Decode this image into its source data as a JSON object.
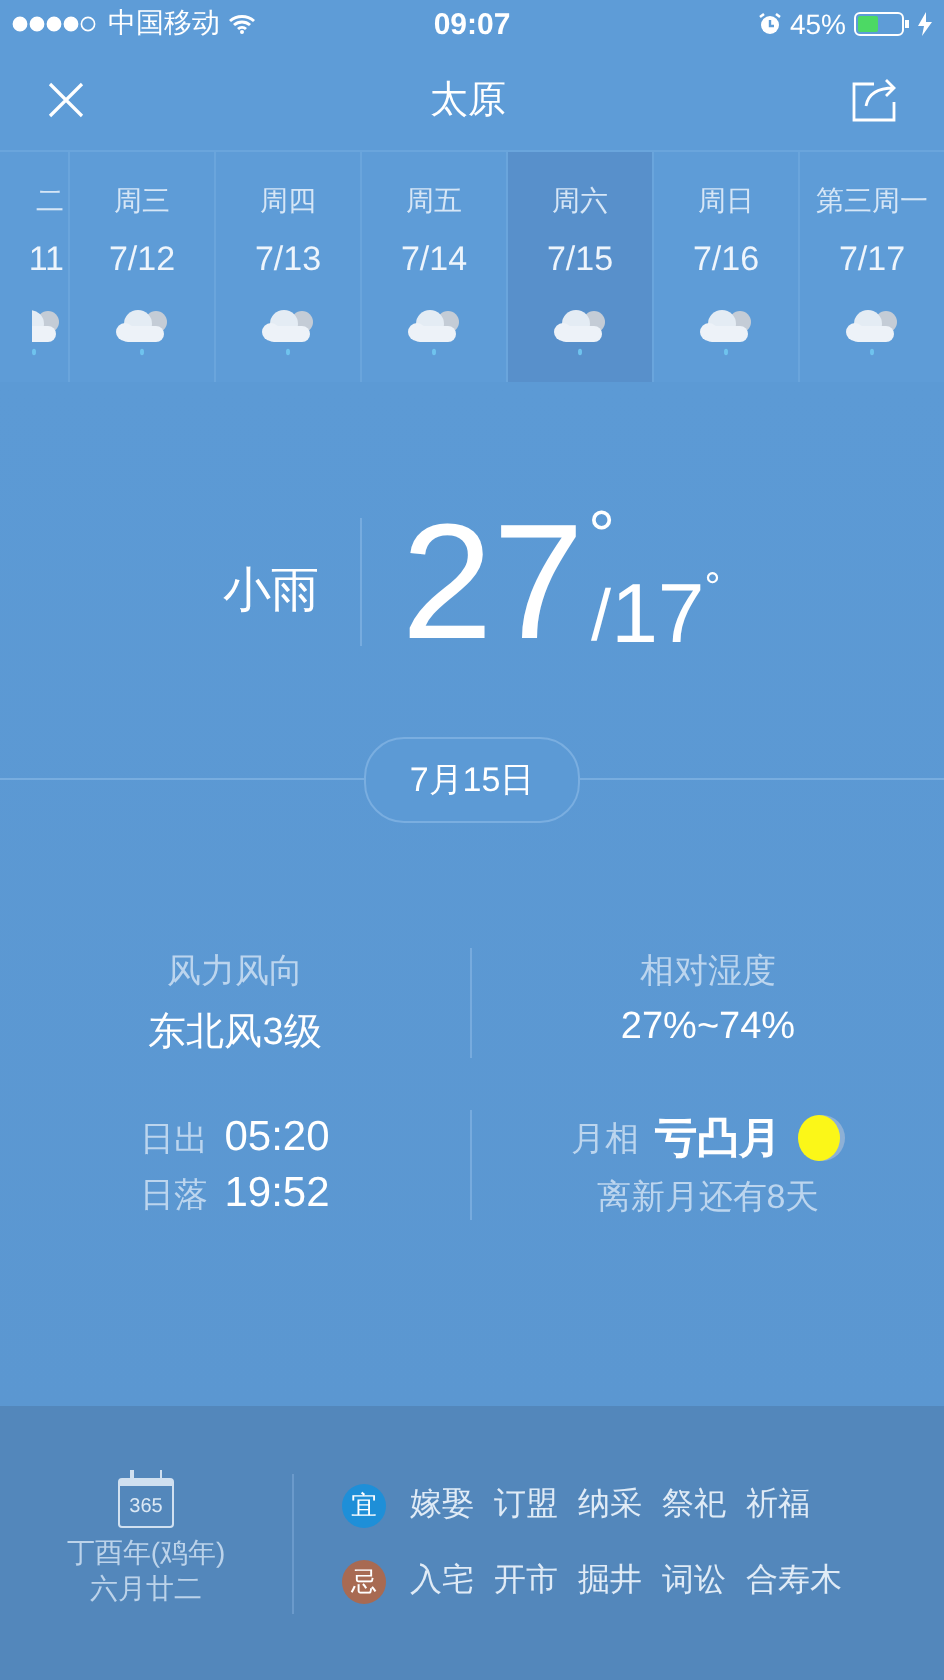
{
  "status_bar": {
    "carrier": "中国移动",
    "time": "09:07",
    "battery": "45%"
  },
  "nav": {
    "title": "太原"
  },
  "days": [
    {
      "label": "二",
      "date": "11",
      "selected": false
    },
    {
      "label": "周三",
      "date": "7/12",
      "selected": false
    },
    {
      "label": "周四",
      "date": "7/13",
      "selected": false
    },
    {
      "label": "周五",
      "date": "7/14",
      "selected": false
    },
    {
      "label": "周六",
      "date": "7/15",
      "selected": true
    },
    {
      "label": "周日",
      "date": "7/16",
      "selected": false
    },
    {
      "label": "第三周一",
      "date": "7/17",
      "selected": false
    }
  ],
  "current": {
    "condition": "小雨",
    "high": "27",
    "high_unit": "°",
    "separator": "/",
    "low": "17",
    "low_unit": "°",
    "date": "7月15日"
  },
  "details": [
    {
      "label": "风力风向",
      "value": "东北风3级"
    },
    {
      "label": "相对湿度",
      "value": "27%~74%"
    }
  ],
  "sun": [
    {
      "label": "日出",
      "time": "05:20"
    },
    {
      "label": "日落",
      "time": "19:52"
    }
  ],
  "moon": {
    "label": "月相",
    "phase": "亏凸月",
    "note": "离新月还有8天"
  },
  "almanac": {
    "calendar_number": "365",
    "year": "丁酉年(鸡年)",
    "lunar_date": "六月廿二",
    "rows": [
      {
        "tag": "宜",
        "color": "#1e8fd8",
        "items": [
          "嫁娶",
          "订盟",
          "纳采",
          "祭祀",
          "祈福"
        ]
      },
      {
        "tag": "忌",
        "color": "#a86a52",
        "items": [
          "入宅",
          "开市",
          "掘井",
          "词讼",
          "合寿木"
        ]
      }
    ]
  }
}
